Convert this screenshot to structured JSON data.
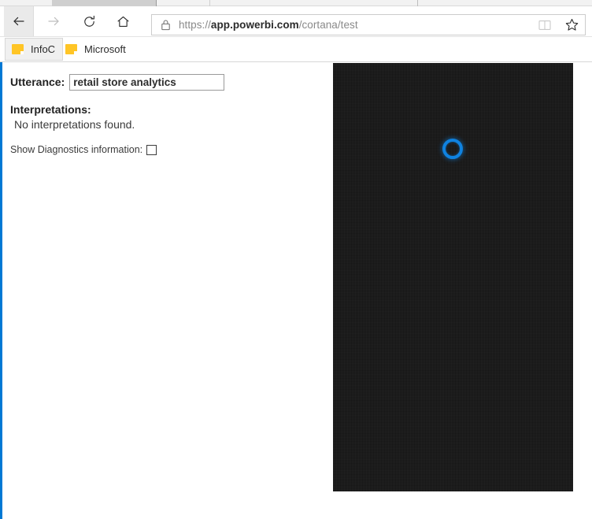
{
  "browser": {
    "nav": {
      "back_label": "Back",
      "forward_label": "Forward",
      "refresh_label": "Refresh",
      "home_label": "Home"
    },
    "address": {
      "scheme": "https://",
      "host": "app.powerbi.com",
      "path": "/cortana/test",
      "full_url": "https://app.powerbi.com/cortana/test",
      "lock_icon": "lock-icon",
      "reading_view_label": "Reading view",
      "favorites_label": "Add to favorites"
    },
    "favorites": {
      "items": [
        {
          "label": "InfoC",
          "icon": "folder-icon"
        },
        {
          "label": "Microsoft",
          "icon": "folder-icon"
        }
      ]
    }
  },
  "page": {
    "utterance": {
      "label": "Utterance:",
      "value": "retail store analytics",
      "placeholder": ""
    },
    "interpretations": {
      "heading": "Interpretations:",
      "empty_message": "No interpretations found."
    },
    "diagnostics": {
      "label": "Show Diagnostics information:",
      "checked": false
    },
    "cortana_canvas": {
      "state": "loading",
      "spinner_name": "loading-spinner",
      "background_color": "#151515",
      "accent_color": "#0f82e0"
    },
    "accent_color": "#0078d4"
  }
}
